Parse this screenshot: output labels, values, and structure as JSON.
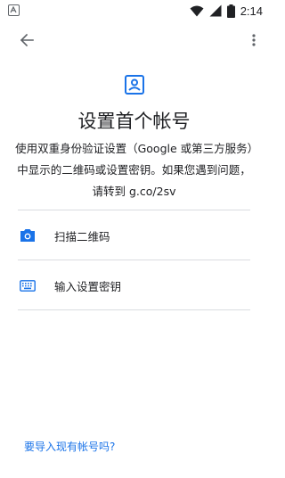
{
  "status_bar": {
    "time": "2:14"
  },
  "header": {
    "title": "设置首个帐号",
    "description": "使用双重身份验证设置（Google 或第三方服务）中显示的二维码或设置密钥。如果您遇到问题，请转到 g.co/2sv"
  },
  "options": [
    {
      "label": "扫描二维码",
      "icon": "camera-icon"
    },
    {
      "label": "输入设置密钥",
      "icon": "keyboard-icon"
    }
  ],
  "footer": {
    "import_link": "要导入现有帐号吗?"
  },
  "colors": {
    "accent": "#1a73e8",
    "icon_gray": "#5f6368",
    "divider": "#dadce0"
  }
}
